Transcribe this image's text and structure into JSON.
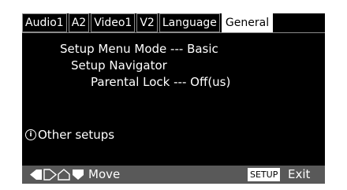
{
  "tabs": [
    {
      "label": "Audio1",
      "active": false
    },
    {
      "label": "A2",
      "active": false
    },
    {
      "label": "Video1",
      "active": false
    },
    {
      "label": "V2",
      "active": false
    },
    {
      "label": "Language",
      "active": false
    },
    {
      "label": "General",
      "active": true
    }
  ],
  "menu": {
    "setup_menu_mode": {
      "label": "Setup Menu Mode",
      "sep": "---",
      "value": "Basic"
    },
    "setup_navigator": {
      "label": "Setup Navigator"
    },
    "parental_lock": {
      "label": "Parental Lock",
      "sep": "---",
      "value": "Off(us)"
    }
  },
  "other_setups": {
    "icon": "info-icon",
    "label": "Other setups"
  },
  "footer": {
    "arrows_icon": "arrow-keys-icon",
    "move_label": "Move",
    "setup_button": "SETUP",
    "exit_label": "Exit"
  }
}
